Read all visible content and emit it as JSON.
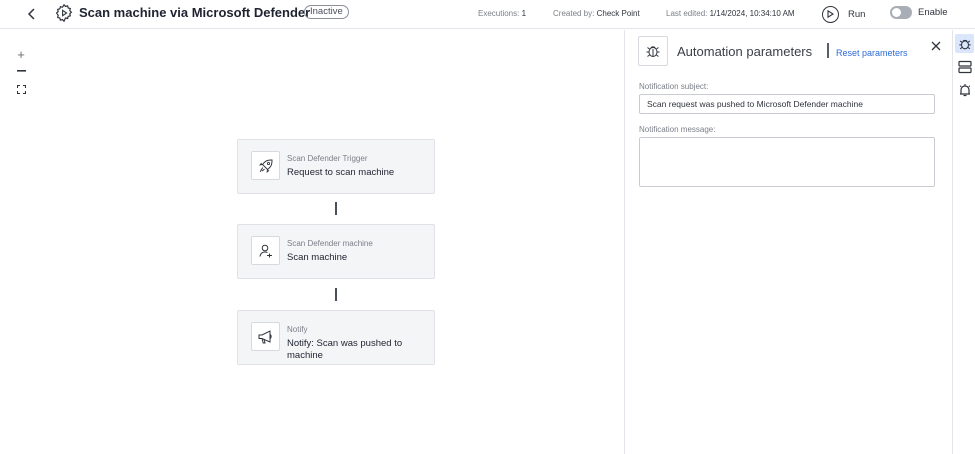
{
  "header": {
    "title": "Scan machine via Microsoft Defender",
    "status_badge": "Inactive",
    "executions_label": "Executions:",
    "executions_value": "1",
    "created_label": "Created by:",
    "created_value": "Check Point",
    "edited_label": "Last edited:",
    "edited_value": "1/14/2024, 10:34:10 AM",
    "run_label": "Run",
    "enable_label": "Enable",
    "enabled": false
  },
  "zoom": {
    "zoom_in": "+",
    "zoom_out": "−"
  },
  "flow": {
    "nodes": [
      {
        "subtitle": "Scan Defender Trigger",
        "title": "Request to scan machine",
        "icon": "rocket-icon"
      },
      {
        "subtitle": "Scan Defender machine",
        "title": "Scan machine",
        "icon": "user-scan-icon"
      },
      {
        "subtitle": "Notify",
        "title": "Notify: Scan was pushed to machine",
        "icon": "megaphone-icon"
      }
    ]
  },
  "panel": {
    "title": "Automation parameters",
    "reset_label": "Reset parameters",
    "subject_label": "Notification subject:",
    "subject_value": "Scan request was pushed to Microsoft Defender machine",
    "message_label": "Notification message:",
    "message_value": ""
  },
  "sidebar": {
    "items": [
      {
        "icon": "bug-icon",
        "active": true
      },
      {
        "icon": "layers-icon",
        "active": false
      },
      {
        "icon": "alarm-icon",
        "active": false
      }
    ]
  },
  "colors": {
    "accent": "#2e6bd9",
    "active_rail_bg": "#d9e6fb",
    "node_bg": "#f4f5f7"
  }
}
